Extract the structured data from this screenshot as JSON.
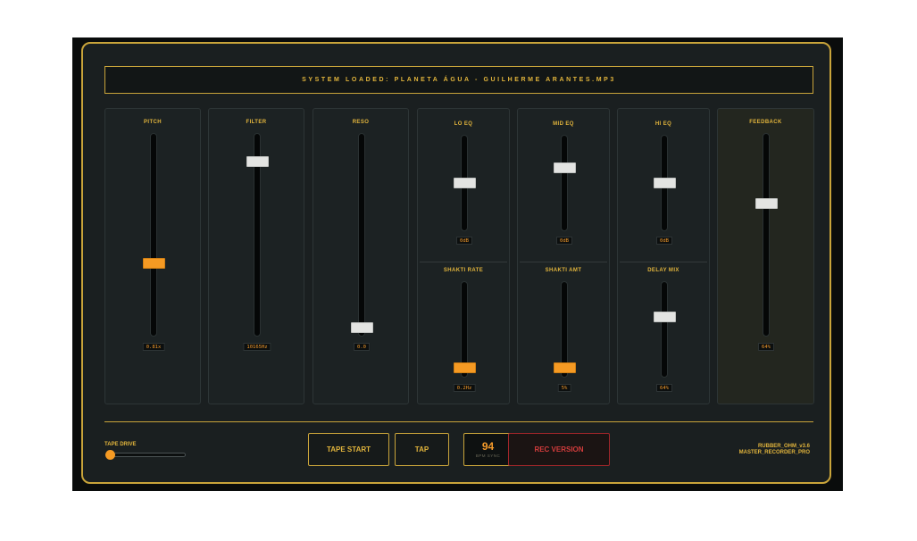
{
  "display": {
    "text": "SYSTEM LOADED: PLANETA ÁGUA - GUILHERME ARANTES.MP3"
  },
  "sliders": {
    "pitch": {
      "label": "PITCH",
      "value": "0.81x",
      "level": 0.35
    },
    "filter": {
      "label": "FILTER",
      "value": "10165Hz",
      "level": 0.88
    },
    "reso": {
      "label": "RESO",
      "value": "0.0",
      "level": 0.02
    },
    "lo_eq": {
      "label": "LO EQ",
      "value": "0dB",
      "level": 0.5
    },
    "mid_eq": {
      "label": "MID EQ",
      "value": "0dB",
      "level": 0.68
    },
    "hi_eq": {
      "label": "HI EQ",
      "value": "0dB",
      "level": 0.5
    },
    "shakti_rate": {
      "label": "SHAKTI RATE",
      "value": "0.2Hz",
      "level": 0.05
    },
    "shakti_amt": {
      "label": "SHAKTI AMT",
      "value": "5%",
      "level": 0.05
    },
    "delay_mix": {
      "label": "DELAY MIX",
      "value": "64%",
      "level": 0.65
    },
    "feedback": {
      "label": "FEEDBACK",
      "value": "64%",
      "level": 0.66
    }
  },
  "tape_drive": {
    "label": "TAPE DRIVE",
    "level": 0.0
  },
  "buttons": {
    "tape_start": "TAPE START",
    "tap": "TAP",
    "rec": "REC VERSION"
  },
  "bpm": {
    "value": "94",
    "label": "BPM SYNC"
  },
  "footer": {
    "line1": "RUBBER_OHM_v3.6",
    "line2": "MASTER_RECORDER_PRO"
  },
  "colors": {
    "accent": "#c9a43a",
    "orange": "#f59a23",
    "rec": "#d23c3c"
  }
}
